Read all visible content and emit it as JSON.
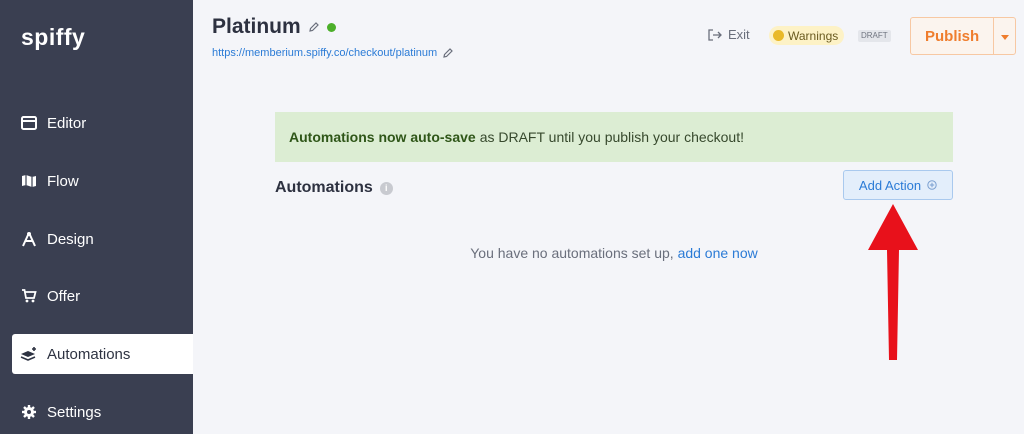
{
  "sidebar": {
    "logo": "spiffy",
    "items": [
      {
        "label": "Editor",
        "icon": "editor-icon"
      },
      {
        "label": "Flow",
        "icon": "map-icon"
      },
      {
        "label": "Design",
        "icon": "compass-icon"
      },
      {
        "label": "Offer",
        "icon": "cart-icon"
      },
      {
        "label": "Automations",
        "icon": "layers-icon",
        "active": true
      },
      {
        "label": "Settings",
        "icon": "gear-icon"
      }
    ]
  },
  "header": {
    "title": "Platinum",
    "url": "https://memberium.spiffy.co/checkout/platinum",
    "exit_label": "Exit",
    "warnings_label": "Warnings",
    "draft_label": "DRAFT",
    "publish_label": "Publish"
  },
  "banner": {
    "bold": "Automations now auto-save",
    "text": "as DRAFT until you publish your checkout!"
  },
  "automations": {
    "title": "Automations",
    "add_action_label": "Add Action",
    "empty_text": "You have no automations set up,",
    "empty_link": "add one now"
  },
  "colors": {
    "sidebar_bg": "#3a3f51",
    "accent_orange": "#ef7d2d",
    "link_blue": "#2b7bd6",
    "banner_bg": "#dcedd3",
    "status_green": "#4caf2a",
    "arrow_red": "#e8111b"
  }
}
